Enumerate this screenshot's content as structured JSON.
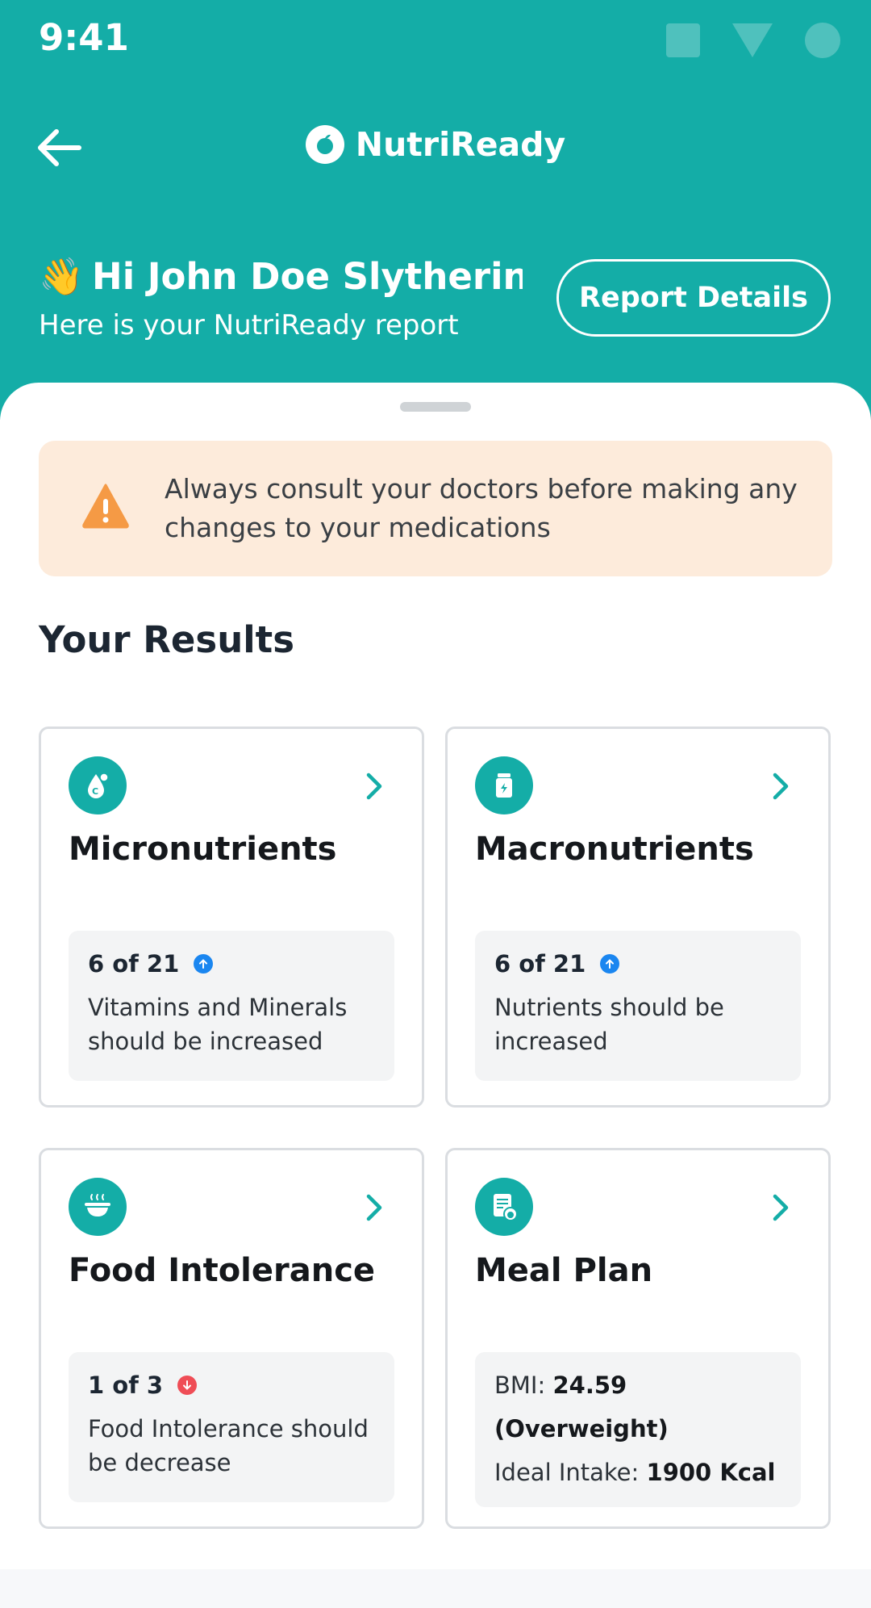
{
  "status_bar": {
    "time": "9:41"
  },
  "app": {
    "name": "NutriReady"
  },
  "greeting": {
    "emoji": "👋",
    "title": "Hi John Doe Slytherin...",
    "subtitle": "Here is your NutriReady report"
  },
  "report_button": {
    "label": "Report Details"
  },
  "alert": {
    "text": "Always consult your doctors before making any changes to your medications"
  },
  "section": {
    "title": "Your Results"
  },
  "cards": [
    {
      "title": "Micronutrients",
      "icon": "vitamin-drop-icon",
      "stat": "6 of 21",
      "trend": "up",
      "description": "Vitamins and Minerals should be increased"
    },
    {
      "title": "Macronutrients",
      "icon": "supplement-jar-icon",
      "stat": "6 of 21",
      "trend": "up",
      "description": "Nutrients should be increased"
    },
    {
      "title": "Food Intolerance",
      "icon": "food-bowl-icon",
      "stat": "1 of 3",
      "trend": "down",
      "description": "Food Intolerance should be decrease"
    },
    {
      "title": "Meal Plan",
      "icon": "meal-plan-icon",
      "bmi_label": "BMI:",
      "bmi_value": "24.59 (Overweight)",
      "intake_label": "Ideal Intake:",
      "intake_value": "1900 Kcal"
    }
  ],
  "colors": {
    "primary": "#14ada7",
    "alert_bg": "#fdebdb",
    "alert_icon": "#f59a45",
    "trend_up": "#1a86f0",
    "trend_down": "#ef4d56"
  }
}
